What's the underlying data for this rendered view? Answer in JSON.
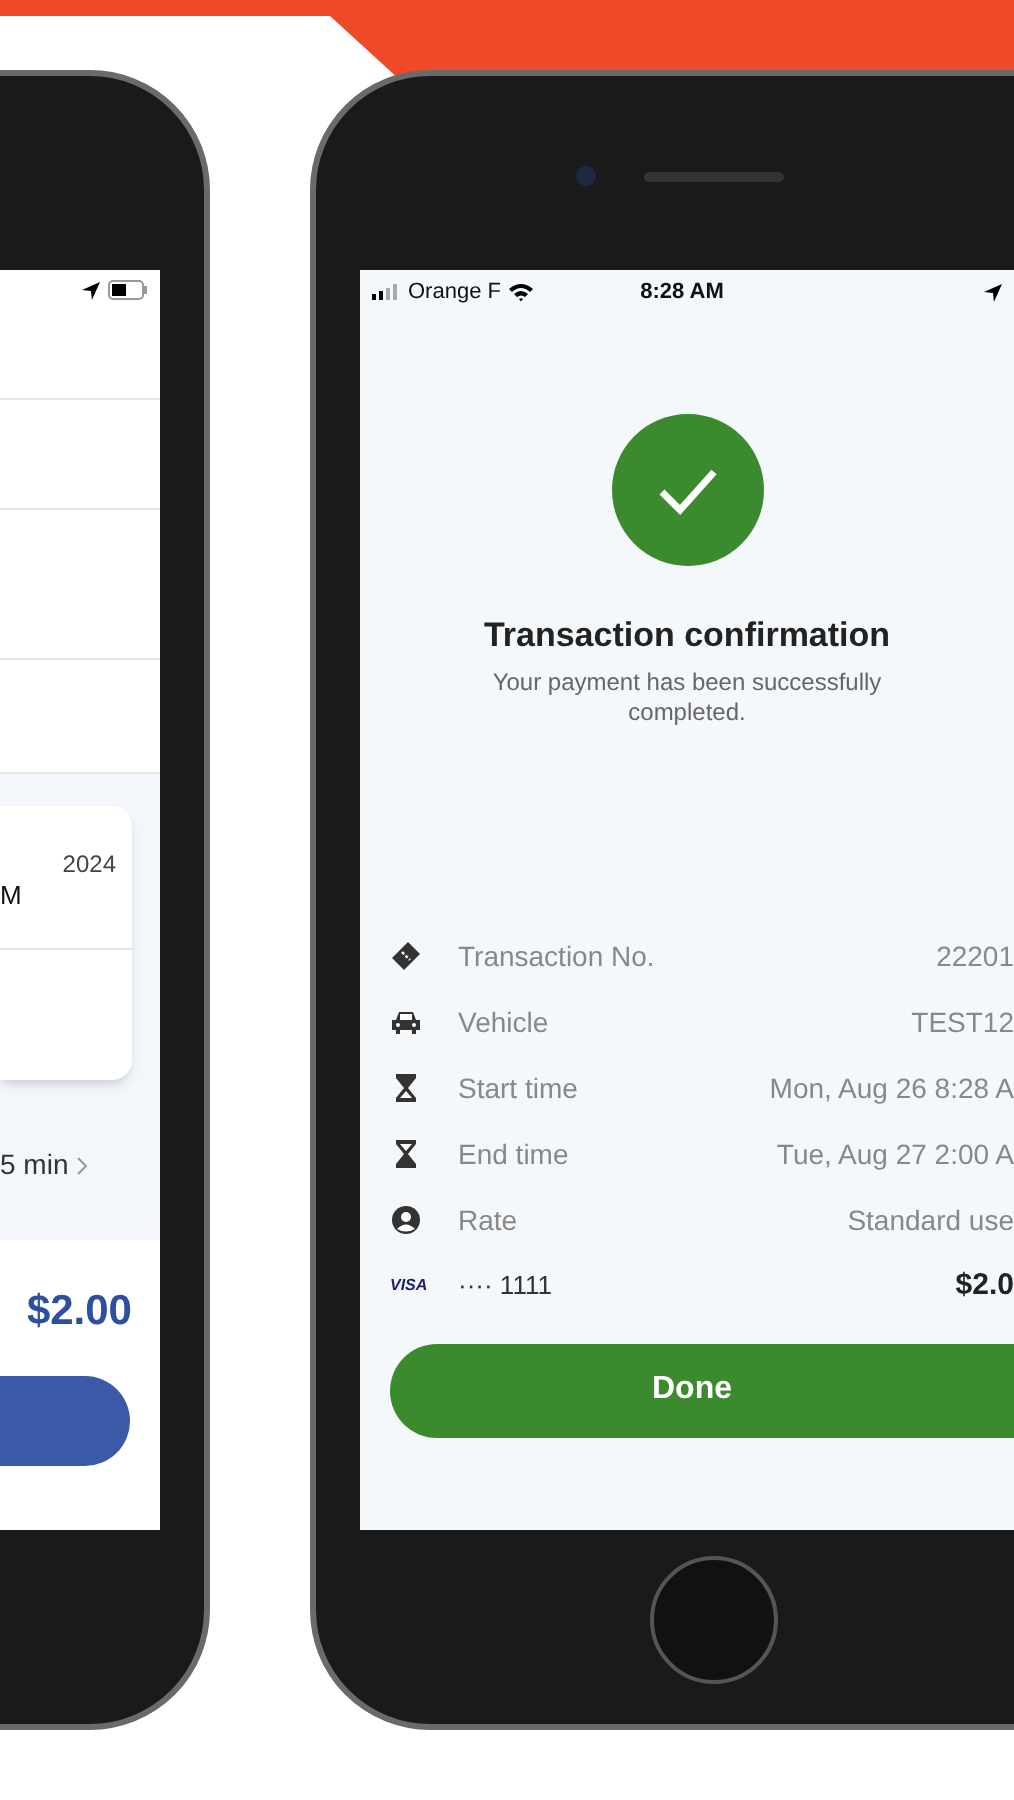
{
  "left_phone": {
    "card": {
      "date": "2024",
      "time": "M"
    },
    "duration": "5 min",
    "total": "$2.00"
  },
  "right_phone": {
    "status_bar": {
      "carrier": "Orange F",
      "time": "8:28 AM"
    },
    "title": "Transaction confirmation",
    "message": "Your payment has been successfully completed.",
    "details": [
      {
        "kind": "ticket",
        "label": "Transaction No.",
        "value": "22201"
      },
      {
        "kind": "vehicle",
        "label": "Vehicle",
        "value": "TEST12"
      },
      {
        "kind": "start",
        "label": "Start time",
        "value": "Mon, Aug 26 8:28 A"
      },
      {
        "kind": "end",
        "label": "End time",
        "value": "Tue, Aug 27 2:00 A"
      },
      {
        "kind": "rate",
        "label": "Rate",
        "value": "Standard use"
      }
    ],
    "payment": {
      "brand": "VISA",
      "card": "···· 1111",
      "amount": "$2.0"
    },
    "button": "Done"
  }
}
